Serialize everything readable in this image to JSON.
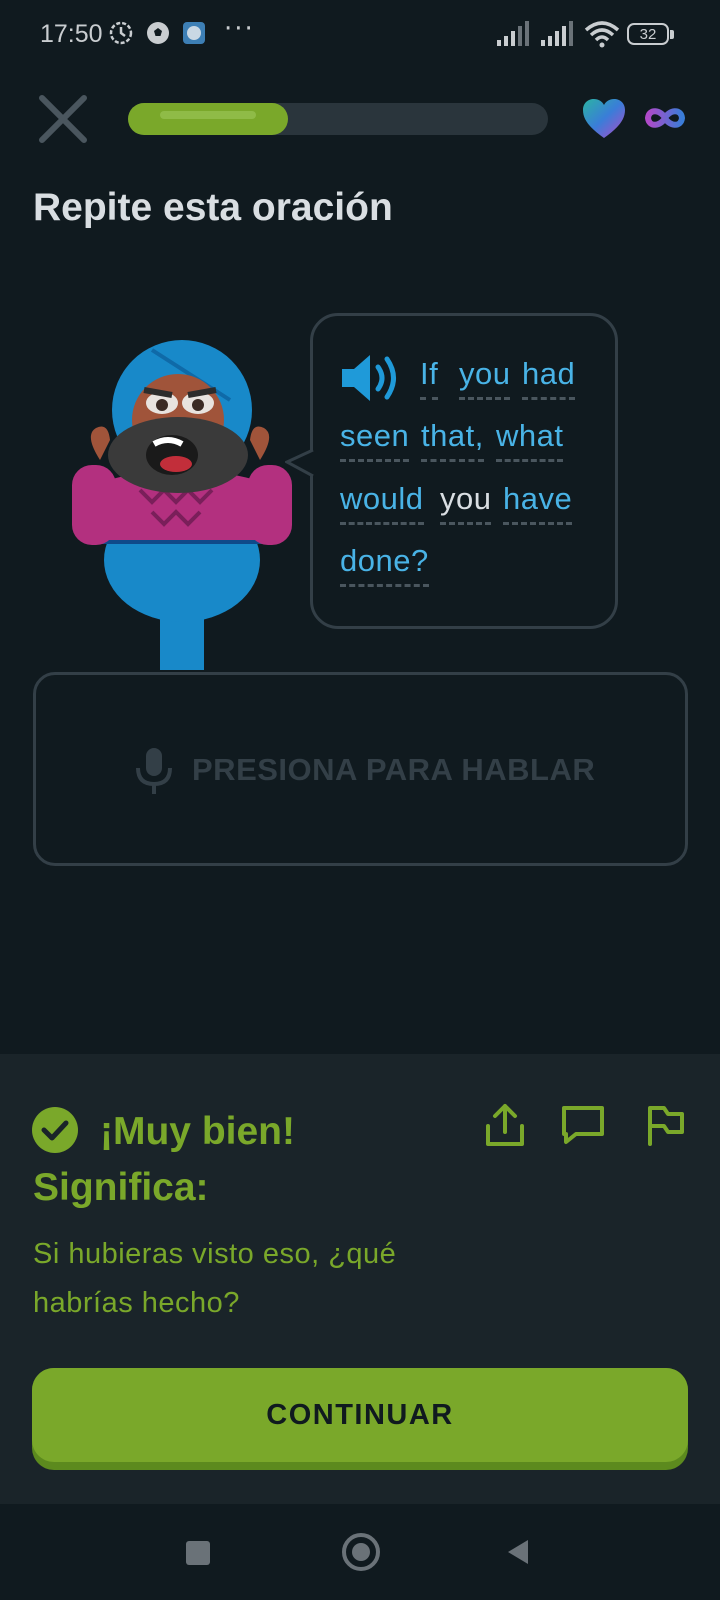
{
  "status_bar": {
    "time": "17:50",
    "icons": [
      "alarm-gear-icon",
      "soccer-ball-icon",
      "gallery-icon"
    ],
    "more": "···",
    "battery": "32"
  },
  "lesson": {
    "progress": 0.38,
    "hearts_icon": "heart-icon",
    "hearts_value": "infinity",
    "prompt_title": "Repite esta oración"
  },
  "bubble": {
    "words": [
      "If",
      "you",
      "had",
      "seen",
      "that,",
      "what",
      "would",
      "you",
      "have",
      "done?"
    ]
  },
  "speak_button": {
    "label": "PRESIONA PARA HABLAR"
  },
  "feedback": {
    "title": "¡Muy bien!",
    "subtitle": "Significa:",
    "translation": "Si hubieras visto eso, ¿qué habrías hecho?",
    "continue_label": "CONTINUAR"
  },
  "colors": {
    "background": "#101a1f",
    "accent_green": "#7aa82a",
    "word_blue": "#49b3e6",
    "panel": "#1a2429"
  }
}
